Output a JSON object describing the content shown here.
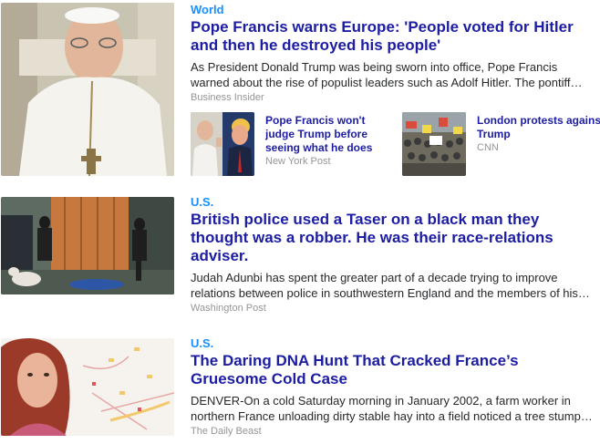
{
  "stories": [
    {
      "category": "World",
      "headline": "Pope Francis warns Europe: 'People voted for Hitler and then he destroyed his people'",
      "summary": "As President Donald Trump was being sworn into office, Pope Francis warned about the rise of populist leaders such as Adolf Hitler. The pontiff…",
      "source": "Business Insider",
      "related": [
        {
          "title": "Pope Francis won't judge Trump before seeing what he does",
          "source": "New York Post"
        },
        {
          "title": "London protests agains Trump",
          "source": "CNN"
        }
      ]
    },
    {
      "category": "U.S.",
      "headline": "British police used a Taser on a black man they thought was a robber. He was their race-relations adviser.",
      "summary": "Judah Adunbi has spent the greater part of a decade trying to improve relations between police in southwestern England and the members of his…",
      "source": "Washington Post"
    },
    {
      "category": "U.S.",
      "headline": "The Daring DNA Hunt That Cracked France’s Gruesome Cold Case",
      "summary": "DENVER-On a cold Saturday morning in January 2002, a farm worker in northern France unloading dirty stable hay into a field noticed a tree stump…",
      "source": "The Daily Beast"
    }
  ],
  "colors": {
    "category": "#188fff",
    "headline": "#1d1da3",
    "summary": "#26282a",
    "source": "#959595"
  }
}
